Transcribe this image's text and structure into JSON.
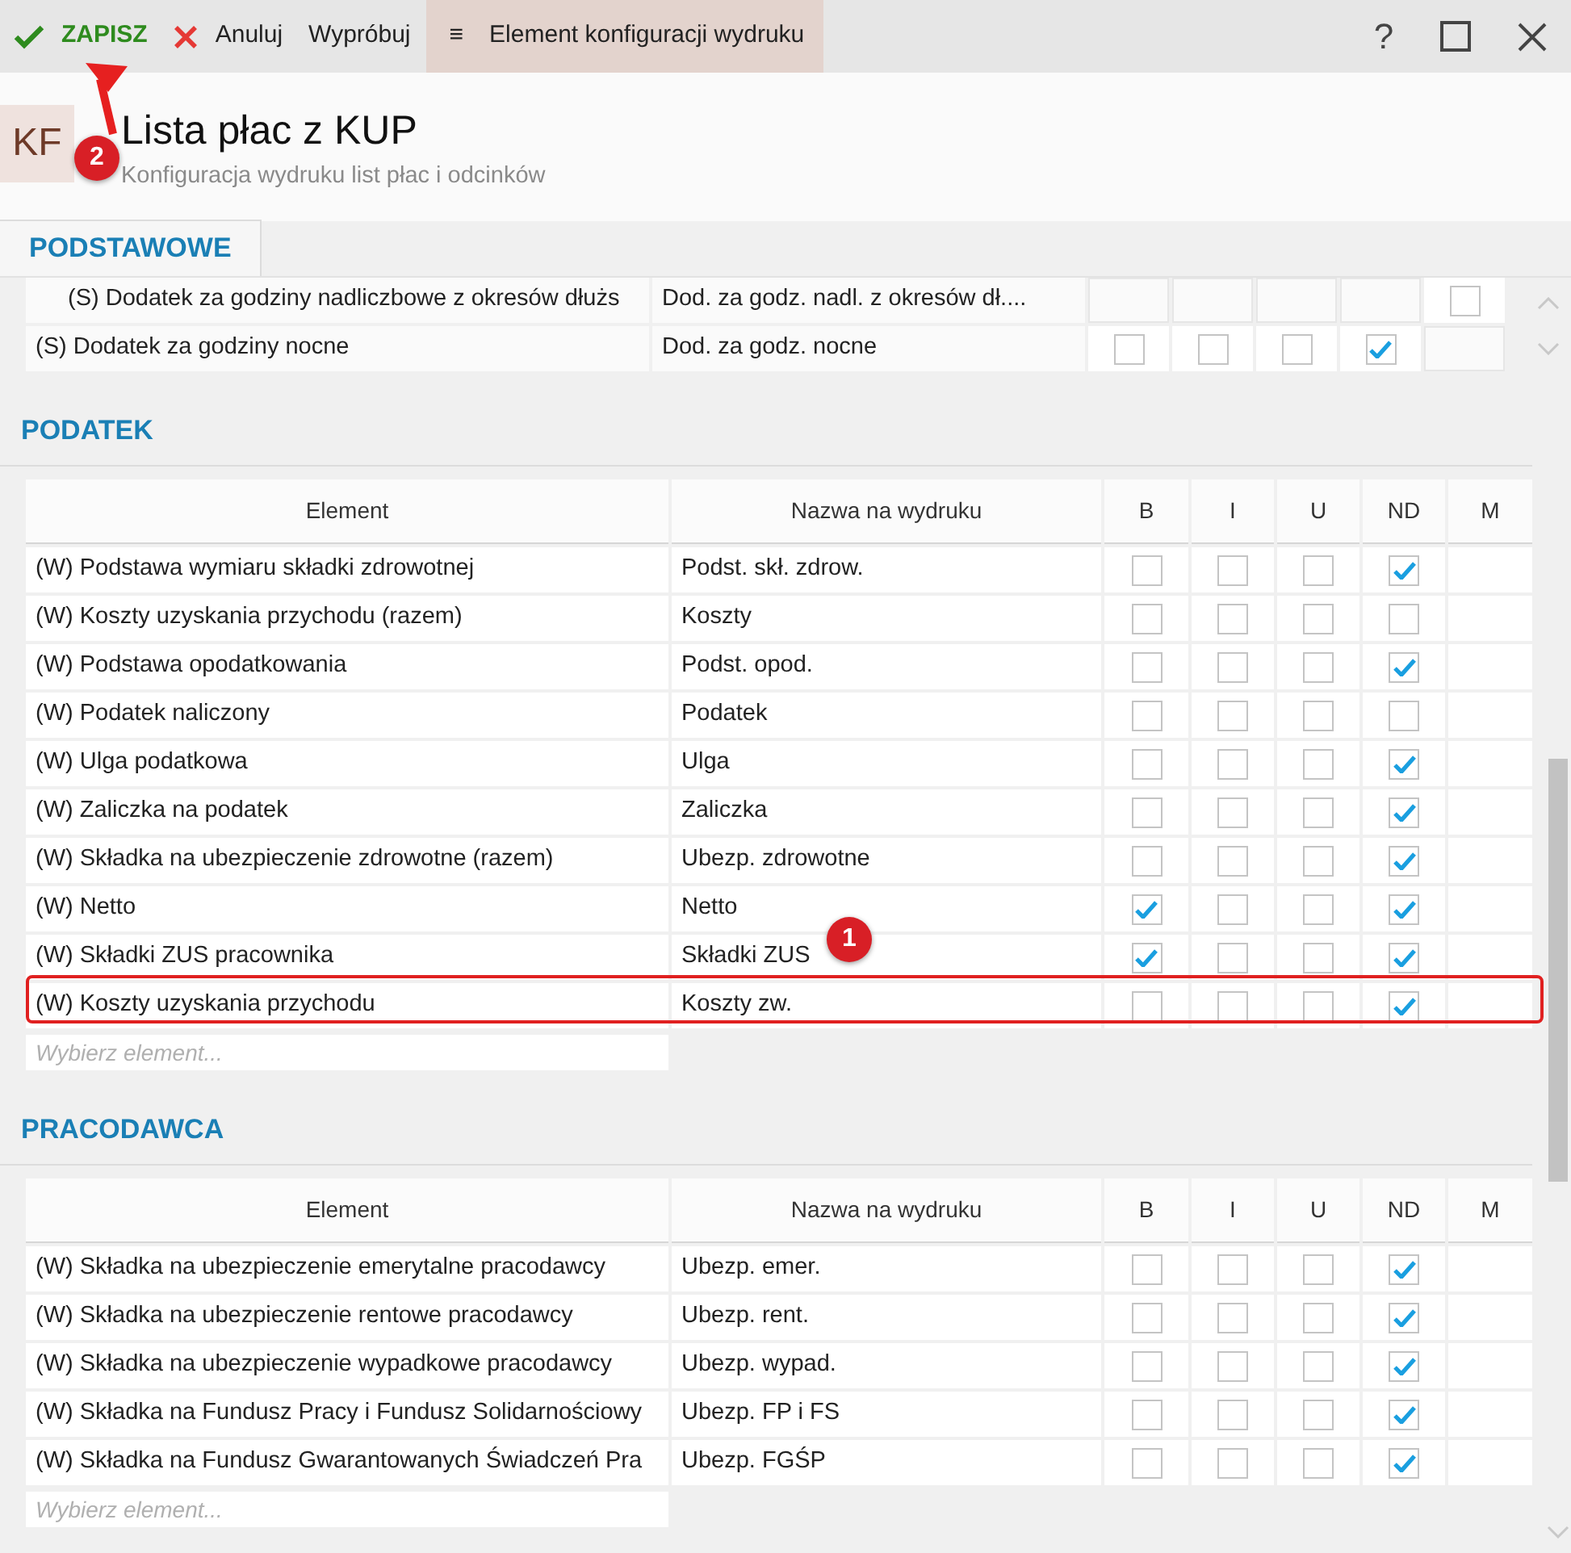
{
  "toolbar": {
    "save": "ZAPISZ",
    "cancel": "Anuluj",
    "try": "Wypróbuj",
    "menu_glyph": "≡",
    "context": "Element konfiguracji wydruku",
    "help": "?"
  },
  "header": {
    "badge": "KF",
    "title": "Lista płac z KUP",
    "subtitle": "Konfiguracja wydruku list płac i odcinków"
  },
  "tabs": [
    {
      "label": "PODSTAWOWE",
      "selected": true
    }
  ],
  "top_table": {
    "rows": [
      {
        "kind": "child",
        "element": "(S) Dodatek za godziny nadliczbowe z okresów dłużs",
        "print_name": "Dod. za godz. nadl. z okresów dł....",
        "cells": [
          {
            "kind": "empty"
          },
          {
            "kind": "empty"
          },
          {
            "kind": "empty"
          },
          {
            "kind": "empty"
          },
          {
            "kind": "box",
            "checked": false
          }
        ]
      },
      {
        "kind": "top",
        "element": "(S) Dodatek za godziny nocne",
        "print_name": "Dod. za godz. nocne",
        "cells": [
          {
            "kind": "box",
            "checked": false
          },
          {
            "kind": "box",
            "checked": false
          },
          {
            "kind": "box",
            "checked": false
          },
          {
            "kind": "box",
            "checked": true
          },
          {
            "kind": "empty"
          }
        ]
      }
    ]
  },
  "sections": [
    {
      "title": "PODATEK",
      "columns": [
        "Element",
        "Nazwa na wydruku",
        "B",
        "I",
        "U",
        "ND",
        "M"
      ],
      "placeholder": "Wybierz element...",
      "rows": [
        {
          "element": "(W) Podstawa wymiaru składki zdrowotnej",
          "print_name": "Podst. skł. zdrow.",
          "flags": [
            false,
            false,
            false,
            true
          ],
          "highlighted": false
        },
        {
          "element": "(W) Koszty uzyskania przychodu (razem)",
          "print_name": "Koszty",
          "flags": [
            false,
            false,
            false,
            false
          ],
          "highlighted": false
        },
        {
          "element": "(W) Podstawa opodatkowania",
          "print_name": "Podst. opod.",
          "flags": [
            false,
            false,
            false,
            true
          ],
          "highlighted": false
        },
        {
          "element": "(W) Podatek naliczony",
          "print_name": "Podatek",
          "flags": [
            false,
            false,
            false,
            false
          ],
          "highlighted": false
        },
        {
          "element": "(W) Ulga podatkowa",
          "print_name": "Ulga",
          "flags": [
            false,
            false,
            false,
            true
          ],
          "highlighted": false
        },
        {
          "element": "(W) Zaliczka na podatek",
          "print_name": "Zaliczka",
          "flags": [
            false,
            false,
            false,
            true
          ],
          "highlighted": false
        },
        {
          "element": "(W) Składka na ubezpieczenie zdrowotne (razem)",
          "print_name": "Ubezp. zdrowotne",
          "flags": [
            false,
            false,
            false,
            true
          ],
          "highlighted": false
        },
        {
          "element": "(W) Netto",
          "print_name": "Netto",
          "flags": [
            true,
            false,
            false,
            true
          ],
          "highlighted": false
        },
        {
          "element": "(W) Składki ZUS pracownika",
          "print_name": "Składki ZUS",
          "flags": [
            true,
            false,
            false,
            true
          ],
          "highlighted": false
        },
        {
          "element": "(W) Koszty uzyskania przychodu",
          "print_name": "Koszty zw.",
          "flags": [
            false,
            false,
            false,
            true
          ],
          "highlighted": true
        }
      ]
    },
    {
      "title": "PRACODAWCA",
      "columns": [
        "Element",
        "Nazwa na wydruku",
        "B",
        "I",
        "U",
        "ND",
        "M"
      ],
      "placeholder": "Wybierz element...",
      "rows": [
        {
          "element": "(W) Składka na ubezpieczenie emerytalne pracodawcy",
          "print_name": "Ubezp. emer.",
          "flags": [
            false,
            false,
            false,
            true
          ],
          "highlighted": false
        },
        {
          "element": "(W) Składka na ubezpieczenie rentowe pracodawcy",
          "print_name": "Ubezp. rent.",
          "flags": [
            false,
            false,
            false,
            true
          ],
          "highlighted": false
        },
        {
          "element": "(W) Składka na ubezpieczenie wypadkowe pracodawcy",
          "print_name": "Ubezp. wypad.",
          "flags": [
            false,
            false,
            false,
            true
          ],
          "highlighted": false
        },
        {
          "element": "(W) Składka na Fundusz Pracy i Fundusz Solidarnościowy",
          "print_name": "Ubezp. FP i FS",
          "flags": [
            false,
            false,
            false,
            true
          ],
          "highlighted": false
        },
        {
          "element": "(W) Składka na Fundusz Gwarantowanych Świadczeń Pra",
          "print_name": "Ubezp. FGŚP",
          "flags": [
            false,
            false,
            false,
            true
          ],
          "highlighted": false
        }
      ]
    }
  ],
  "annotations": [
    {
      "number": "1"
    },
    {
      "number": "2"
    }
  ]
}
